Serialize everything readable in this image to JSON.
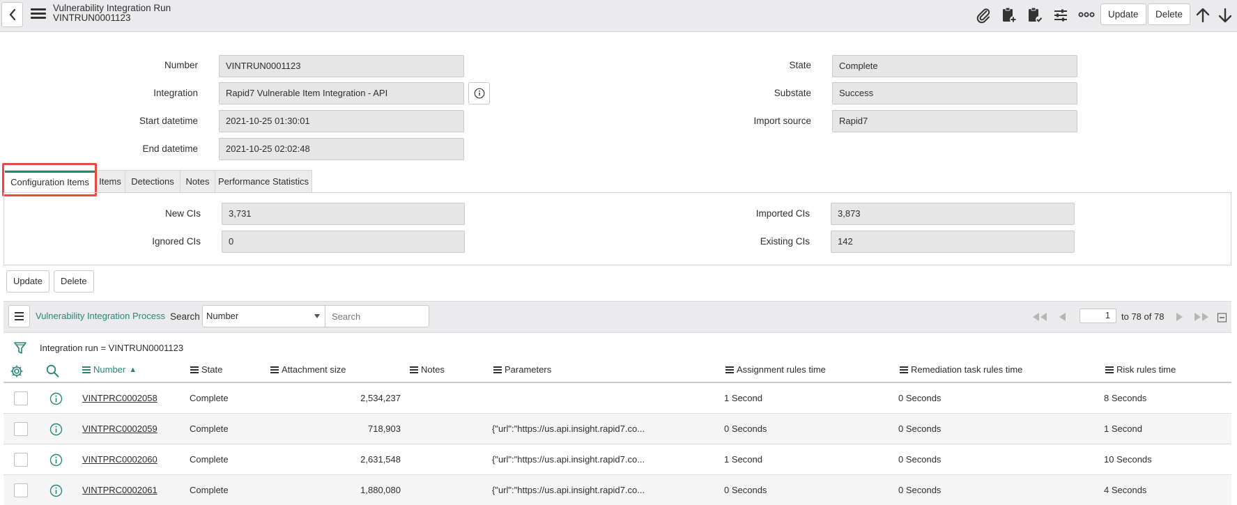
{
  "header": {
    "title": "Vulnerability Integration Run",
    "subtitle": "VINTRUN0001123",
    "update_label": "Update",
    "delete_label": "Delete",
    "icons": [
      "back-icon",
      "menu-icon",
      "paperclip-icon",
      "clipboard-plus-icon",
      "clipboard-check-icon",
      "sliders-icon",
      "more-icon",
      "arrow-up-icon",
      "arrow-down-icon"
    ]
  },
  "form": {
    "number": {
      "label": "Number",
      "value": "VINTRUN0001123"
    },
    "integration": {
      "label": "Integration",
      "value": "Rapid7 Vulnerable Item Integration - API"
    },
    "start": {
      "label": "Start datetime",
      "value": "2021-10-25 01:30:01"
    },
    "end": {
      "label": "End datetime",
      "value": "2021-10-25 02:02:48"
    },
    "state": {
      "label": "State",
      "value": "Complete"
    },
    "substate": {
      "label": "Substate",
      "value": "Success"
    },
    "import_source": {
      "label": "Import source",
      "value": "Rapid7"
    }
  },
  "tabs": [
    {
      "label": "Configuration Items",
      "active": true
    },
    {
      "label": "Items",
      "active": false
    },
    {
      "label": "Detections",
      "active": false
    },
    {
      "label": "Notes",
      "active": false
    },
    {
      "label": "Performance Statistics",
      "active": false
    }
  ],
  "ci": {
    "new": {
      "label": "New CIs",
      "value": "3,731"
    },
    "ignored": {
      "label": "Ignored CIs",
      "value": "0"
    },
    "imported": {
      "label": "Imported CIs",
      "value": "3,873"
    },
    "existing": {
      "label": "Existing CIs",
      "value": "142"
    }
  },
  "form_buttons": {
    "update": "Update",
    "delete": "Delete"
  },
  "list": {
    "title": "Vulnerability Integration Process",
    "search_label": "Search",
    "search_field": "Number",
    "search_placeholder": "Search",
    "page": "1",
    "page_text": "to 78 of 78",
    "filter": "Integration run = VINTRUN0001123",
    "columns": [
      "Number",
      "State",
      "Attachment size",
      "Notes",
      "Parameters",
      "Assignment rules time",
      "Remediation task rules time",
      "Risk rules time"
    ],
    "sort_indicator": "▲",
    "rows": [
      {
        "number": "VINTPRC0002058",
        "state": "Complete",
        "size": "2,534,237",
        "notes": "",
        "params": "",
        "assign": "1 Second",
        "remed": "0 Seconds",
        "risk": "8 Seconds"
      },
      {
        "number": "VINTPRC0002059",
        "state": "Complete",
        "size": "718,903",
        "notes": "",
        "params": "{\"url\":\"https://us.api.insight.rapid7.co...",
        "assign": "0 Seconds",
        "remed": "0 Seconds",
        "risk": "1 Second"
      },
      {
        "number": "VINTPRC0002060",
        "state": "Complete",
        "size": "2,631,548",
        "notes": "",
        "params": "{\"url\":\"https://us.api.insight.rapid7.co...",
        "assign": "1 Second",
        "remed": "0 Seconds",
        "risk": "10 Seconds"
      },
      {
        "number": "VINTPRC0002061",
        "state": "Complete",
        "size": "1,880,080",
        "notes": "",
        "params": "{\"url\":\"https://us.api.insight.rapid7.co...",
        "assign": "0 Seconds",
        "remed": "0 Seconds",
        "risk": "4 Seconds"
      }
    ]
  },
  "colors": {
    "accent": "#278574",
    "highlight": "#e34b43",
    "header_bg": "#ebebed",
    "field_bg": "#e6e6e6"
  }
}
